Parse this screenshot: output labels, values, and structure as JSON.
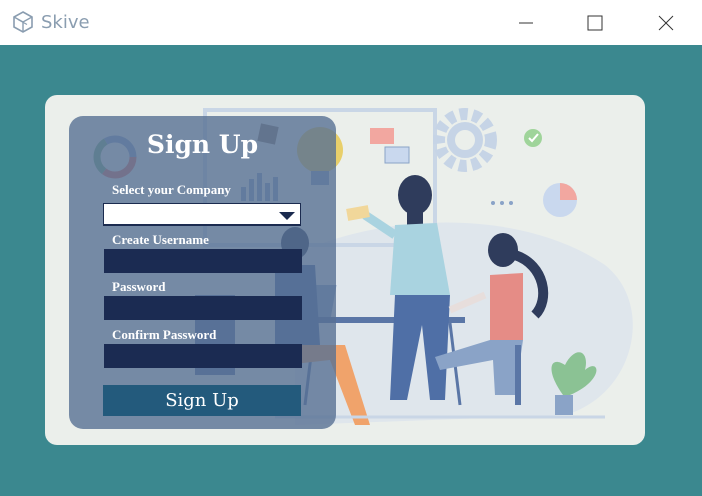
{
  "window": {
    "title": "Skive",
    "minimize_icon": "minimize-icon",
    "maximize_icon": "maximize-icon",
    "close_icon": "close-icon"
  },
  "colors": {
    "client_background": "#3b888f",
    "card_background": "#ebefeb",
    "form_panel": "#577094",
    "input_fill": "#1b2b52",
    "button_fill": "#235a7c"
  },
  "form": {
    "title": "Sign Up",
    "company": {
      "label": "Select your Company",
      "value": ""
    },
    "username": {
      "label": "Create Username",
      "value": ""
    },
    "password": {
      "label": "Password",
      "value": ""
    },
    "confirm_password": {
      "label": "Confirm Password",
      "value": ""
    },
    "submit_label": "Sign Up"
  }
}
